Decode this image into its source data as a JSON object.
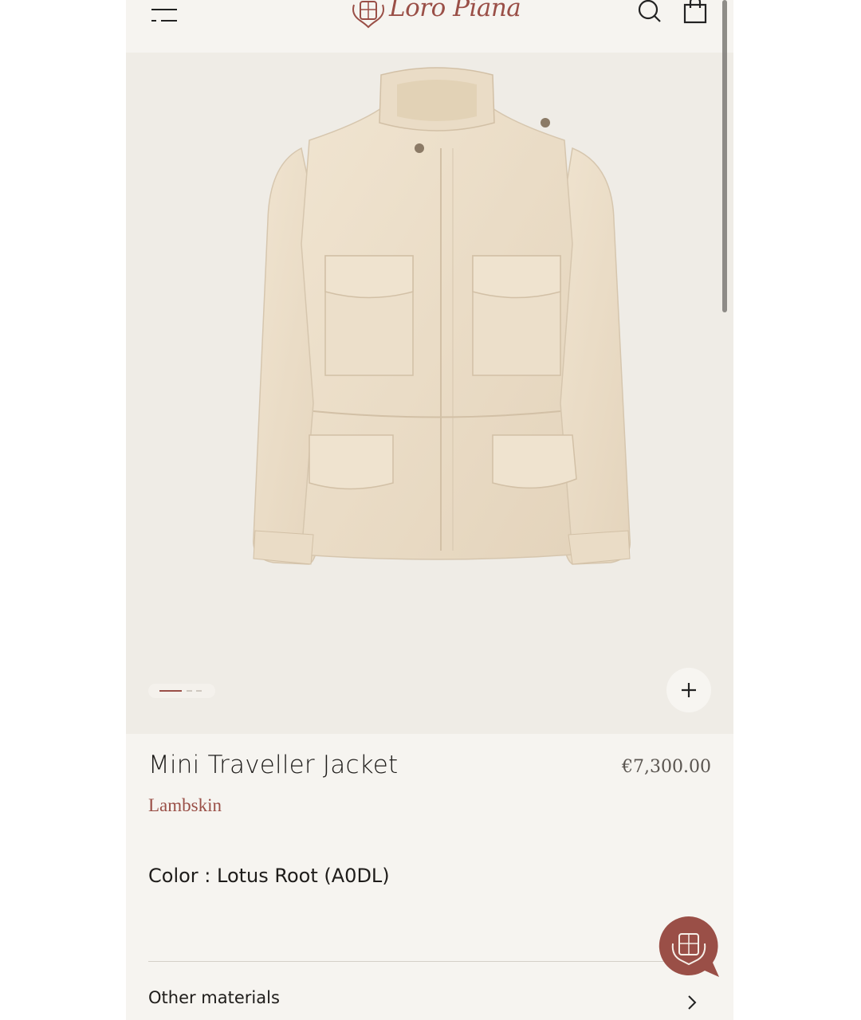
{
  "header": {
    "brand": "Loro Piana",
    "menu_icon": "menu-icon",
    "search_icon": "search-icon",
    "bag_icon": "shopping-bag-icon"
  },
  "gallery": {
    "image_alt": "Mini Traveller Jacket",
    "current_slide": 1,
    "slide_count": 3,
    "zoom_icon": "plus-icon"
  },
  "product": {
    "name": "Mini Traveller Jacket",
    "price": "€7,300.00",
    "material": "Lambskin",
    "color_label": "Color : Lotus Root (A0DL)"
  },
  "sections": {
    "other_materials": "Other materials"
  },
  "colors": {
    "brand": "#9a4f47",
    "background": "#f6f4f0",
    "image_background": "#efece6",
    "text": "#1e1c1a"
  }
}
